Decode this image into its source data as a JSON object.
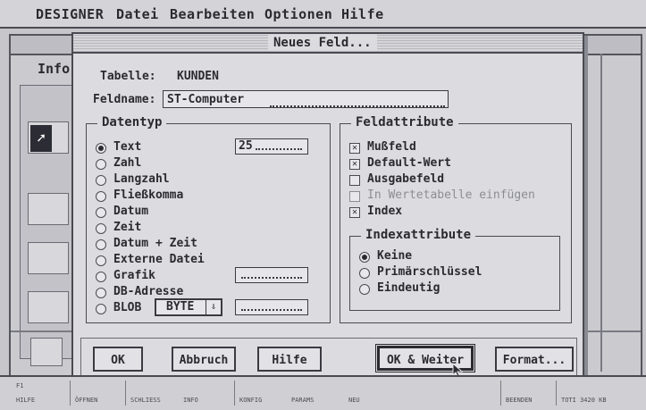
{
  "menubar": {
    "items": [
      "DESIGNER",
      "Datei",
      "Bearbeiten",
      "Optionen",
      "Hilfe"
    ]
  },
  "background": {
    "info_title": "Info",
    "fkey_labels": [
      "F1",
      "HILFE",
      "ÖFFNEN",
      "SCHLIESS",
      "INFO",
      "KONFIG",
      "PARAMS",
      "NEU",
      "BEENDEN",
      "TOTI 3420 KB"
    ]
  },
  "dialog": {
    "title": "Neues Feld...",
    "table_label": "Tabelle:",
    "table_value": "KUNDEN",
    "fieldname_label": "Feldname:",
    "fieldname_value": "ST-Computer",
    "datatype_group": "Datentyp",
    "datatypes": [
      "Text",
      "Zahl",
      "Langzahl",
      "Fließkomma",
      "Datum",
      "Zeit",
      "Datum + Zeit",
      "Externe Datei",
      "Grafik",
      "DB-Adresse",
      "BLOB"
    ],
    "datatype_selected": "Text",
    "text_length": "25",
    "blob_type": "BYTE",
    "attributes_group": "Feldattribute",
    "attributes": [
      {
        "label": "Mußfeld",
        "checked": true,
        "enabled": true
      },
      {
        "label": "Default-Wert",
        "checked": true,
        "enabled": true
      },
      {
        "label": "Ausgabefeld",
        "checked": false,
        "enabled": true
      },
      {
        "label": "In Wertetabelle einfügen",
        "checked": false,
        "enabled": false
      },
      {
        "label": "Index",
        "checked": true,
        "enabled": true
      }
    ],
    "index_group": "Indexattribute",
    "index_options": [
      "Keine",
      "Primärschlüssel",
      "Eindeutig"
    ],
    "index_selected": "Keine",
    "buttons": {
      "ok": "OK",
      "cancel": "Abbruch",
      "help": "Hilfe",
      "ok_next": "OK & Weiter",
      "format": "Format..."
    }
  }
}
